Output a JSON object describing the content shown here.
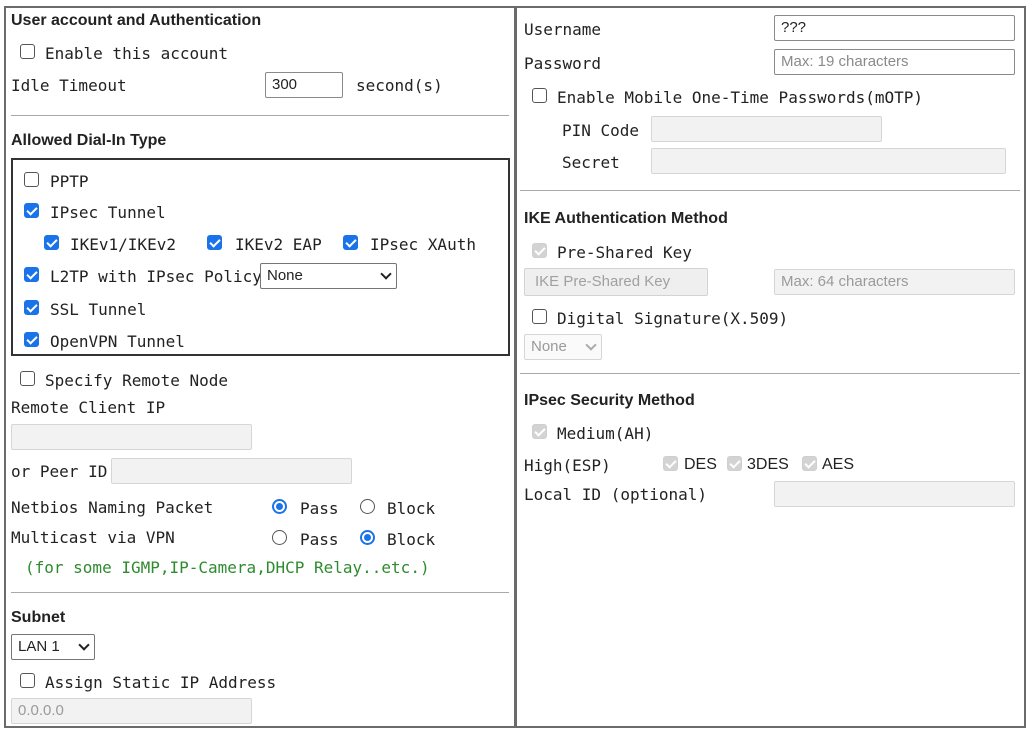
{
  "left": {
    "auth_title": "User account and Authentication",
    "enable_account": "Enable this account",
    "idle_timeout_label": "Idle Timeout",
    "idle_timeout_value": "300",
    "idle_timeout_unit": "second(s)",
    "dialin_title": "Allowed Dial-In Type",
    "pptp": "PPTP",
    "ipsec_tunnel": "IPsec Tunnel",
    "ikev1": "IKEv1/IKEv2",
    "ikev2_eap": "IKEv2 EAP",
    "ipsec_xauth": "IPsec XAuth",
    "l2tp": "L2TP with IPsec Policy",
    "l2tp_policy": "None",
    "ssl_tunnel": "SSL Tunnel",
    "openvpn_tunnel": "OpenVPN Tunnel",
    "specify_remote": "Specify Remote Node",
    "remote_client_ip": "Remote Client IP",
    "peer_id": "or Peer ID",
    "netbios_label": "Netbios Naming Packet",
    "multicast_label": "Multicast via VPN",
    "pass": "Pass",
    "block": "Block",
    "multicast_note": "(for some IGMP,IP-Camera,DHCP Relay..etc.)",
    "subnet_title": "Subnet",
    "subnet_value": "LAN 1",
    "assign_static": "Assign Static IP Address",
    "static_ip_value": "0.0.0.0"
  },
  "right": {
    "username_label": "Username",
    "username_value": "???",
    "password_label": "Password",
    "password_placeholder": "Max: 19 characters",
    "motp": "Enable Mobile One-Time Passwords(mOTP)",
    "pin_code": "PIN Code",
    "secret": "Secret",
    "ike_title": "IKE Authentication Method",
    "psk": "Pre-Shared Key",
    "ike_psk_button": "IKE Pre-Shared Key",
    "psk_placeholder": "Max: 64 characters",
    "digital_sig": "Digital Signature(X.509)",
    "digital_sig_value": "None",
    "ipsec_title": "IPsec Security Method",
    "medium": "Medium(AH)",
    "high": "High(ESP)",
    "des": "DES",
    "3des": "3DES",
    "aes": "AES",
    "local_id": "Local ID (optional)"
  },
  "colors": {
    "accent": "#1a73e8",
    "note_green": "#2e8b2e"
  }
}
